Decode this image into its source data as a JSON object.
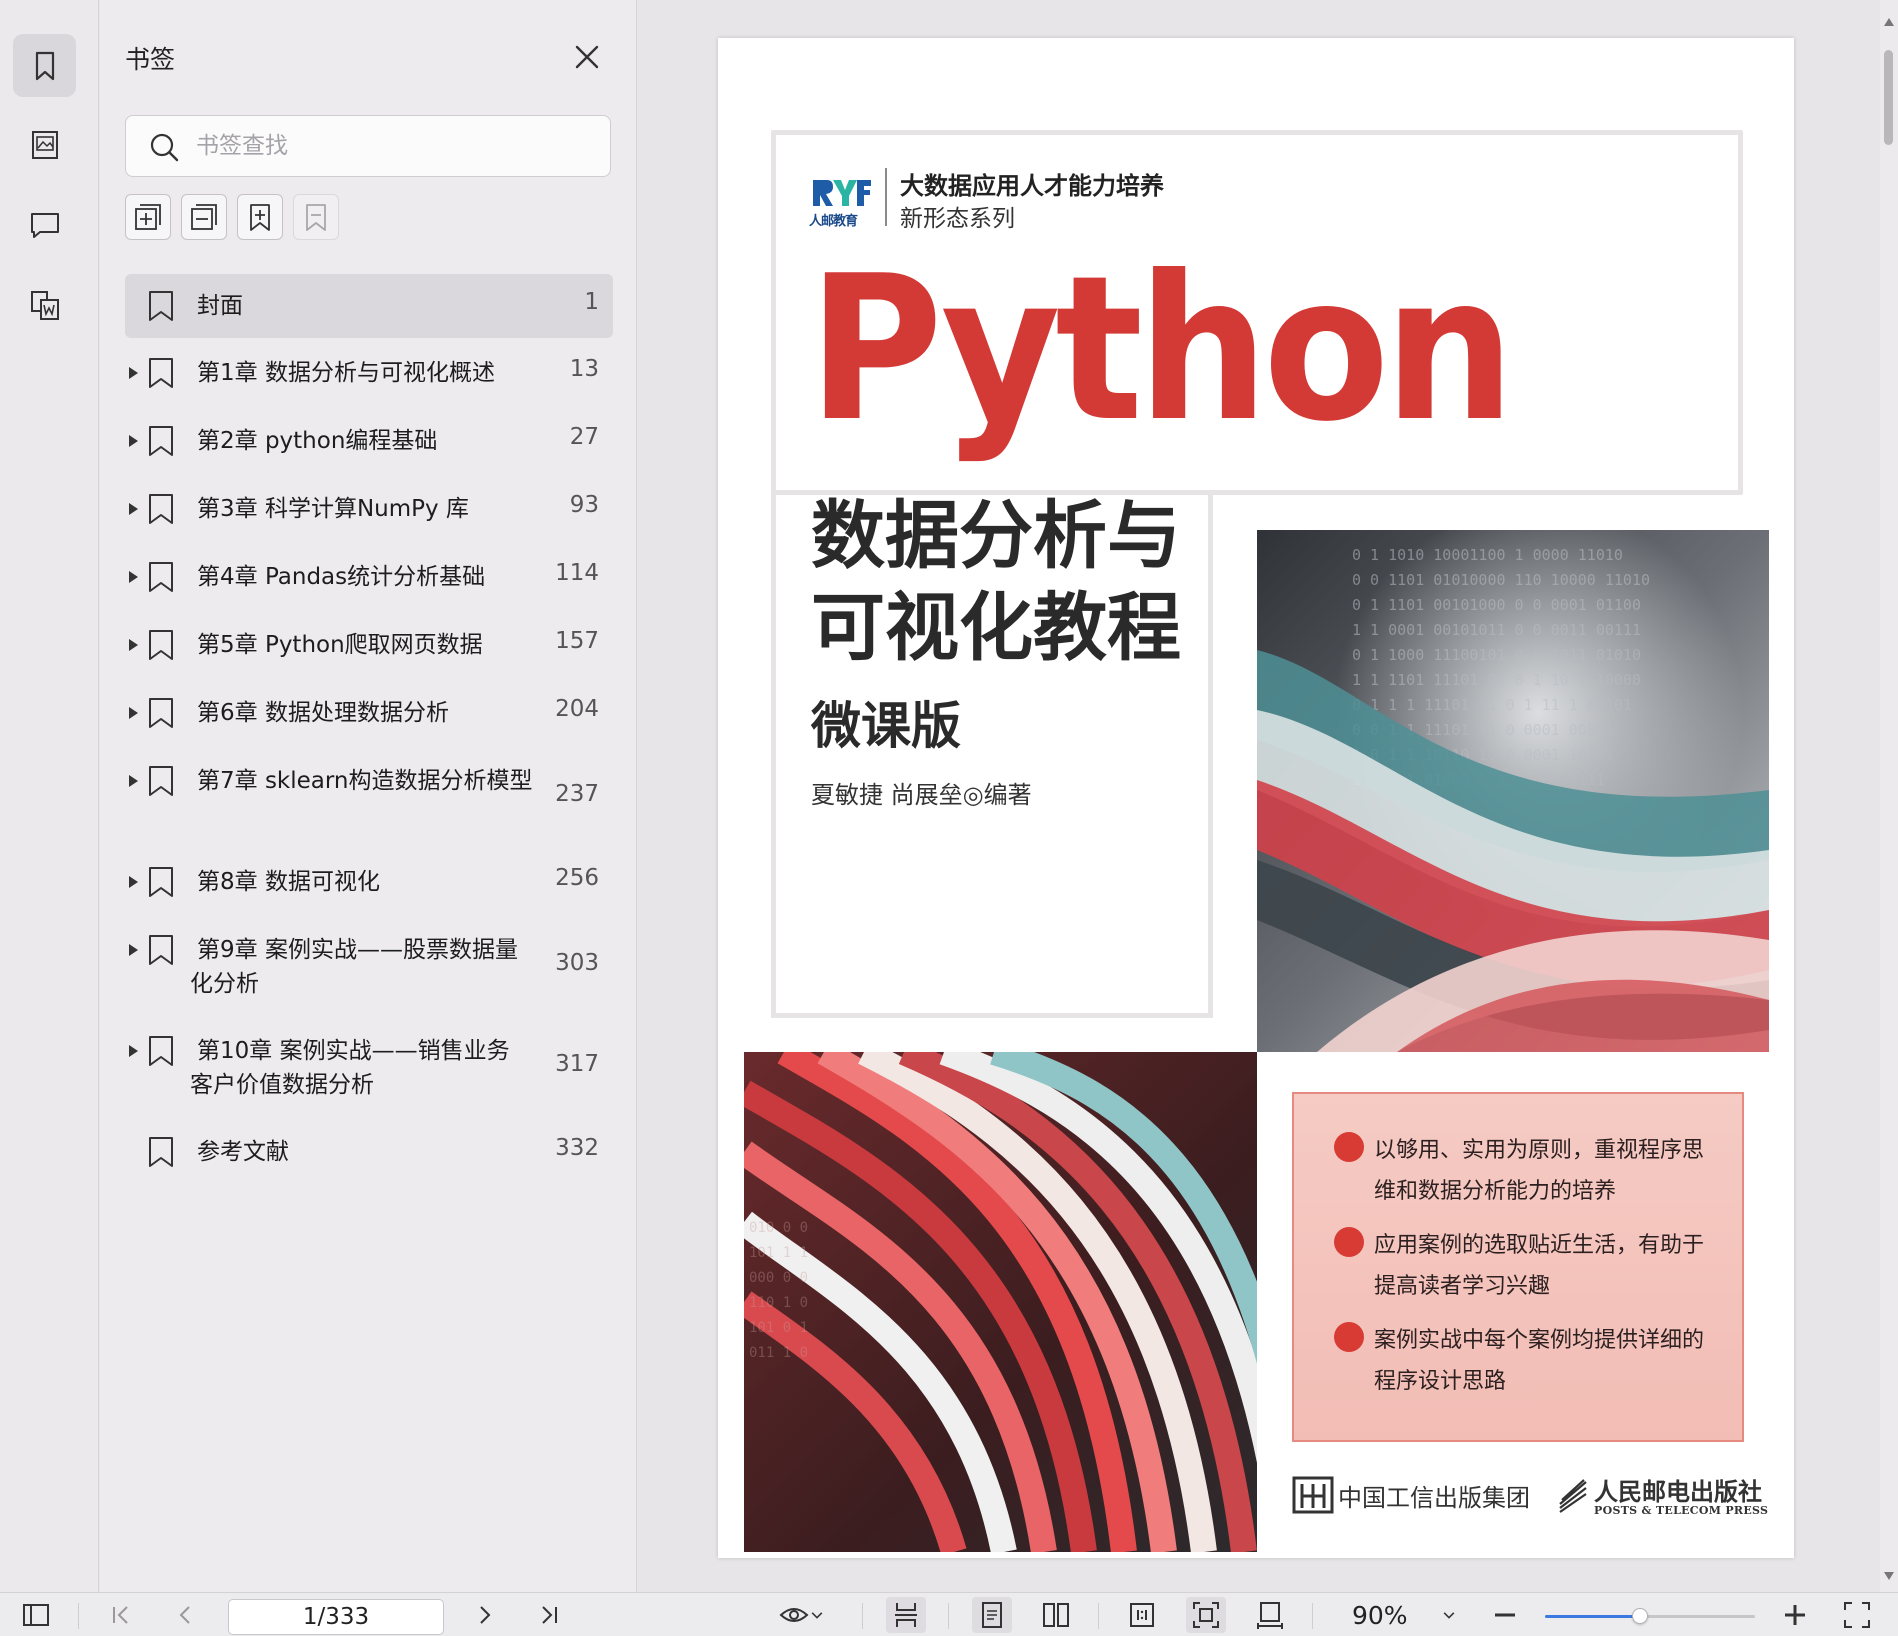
{
  "sidebar_rail": {
    "items": [
      {
        "name": "bookmark-icon",
        "active": true
      },
      {
        "name": "thumbnail-icon",
        "active": false
      },
      {
        "name": "comment-icon",
        "active": false
      },
      {
        "name": "word-convert-icon",
        "active": false
      }
    ]
  },
  "bookmark_panel": {
    "title": "书签",
    "search_placeholder": "书签查找",
    "tools": [
      "expand-all-icon",
      "collapse-all-icon",
      "add-bookmark-icon",
      "delete-bookmark-icon"
    ],
    "items": [
      {
        "label": "封面",
        "page": "1",
        "expandable": false,
        "selected": true
      },
      {
        "label": "第1章 数据分析与可视化概述",
        "page": "13",
        "expandable": true
      },
      {
        "label": "第2章 python编程基础",
        "page": "27",
        "expandable": true
      },
      {
        "label": "第3章 科学计算NumPy 库",
        "page": "93",
        "expandable": true
      },
      {
        "label": "第4章 Pandas统计分析基础",
        "page": "114",
        "expandable": true
      },
      {
        "label": "第5章 Python爬取网页数据",
        "page": "157",
        "expandable": true
      },
      {
        "label": "第6章 数据处理数据分析",
        "page": "204",
        "expandable": true
      },
      {
        "label": "第7章 sklearn构造数据分析模型",
        "page": "237",
        "expandable": true
      },
      {
        "label": "第8章 数据可视化",
        "page": "256",
        "expandable": true
      },
      {
        "label": "第9章 案例实战——股票数据量化分析",
        "page": "303",
        "expandable": true
      },
      {
        "label": "第10章 案例实战——销售业务客户价值数据分析",
        "page": "317",
        "expandable": true
      },
      {
        "label": "参考文献",
        "page": "332",
        "expandable": false
      }
    ]
  },
  "document": {
    "series_logo_text": "人邮教育",
    "series_title": "大数据应用人才能力培养",
    "series_subtitle": "新形态系列",
    "title_en": "Python",
    "title_cn_line1": "数据分析与",
    "title_cn_line2": "可视化教程",
    "edition": "微课版",
    "author": "夏敏捷 尚展垒◎编著",
    "features": [
      "以够用、实用为原则，重视程序思维和数据分析能力的培养",
      "应用案例的选取贴近生活，有助于提高读者学习兴趣",
      "案例实战中每个案例均提供详细的程序设计思路"
    ],
    "publisher1": "中国工信出版集团",
    "publisher2": "人民邮电出版社",
    "publisher2_en": "POSTS & TELECOM PRESS",
    "accent_red": "#d43a35"
  },
  "bottom_toolbar": {
    "page_indicator": "1/333",
    "zoom": "90%",
    "zoom_level": 0.45
  }
}
